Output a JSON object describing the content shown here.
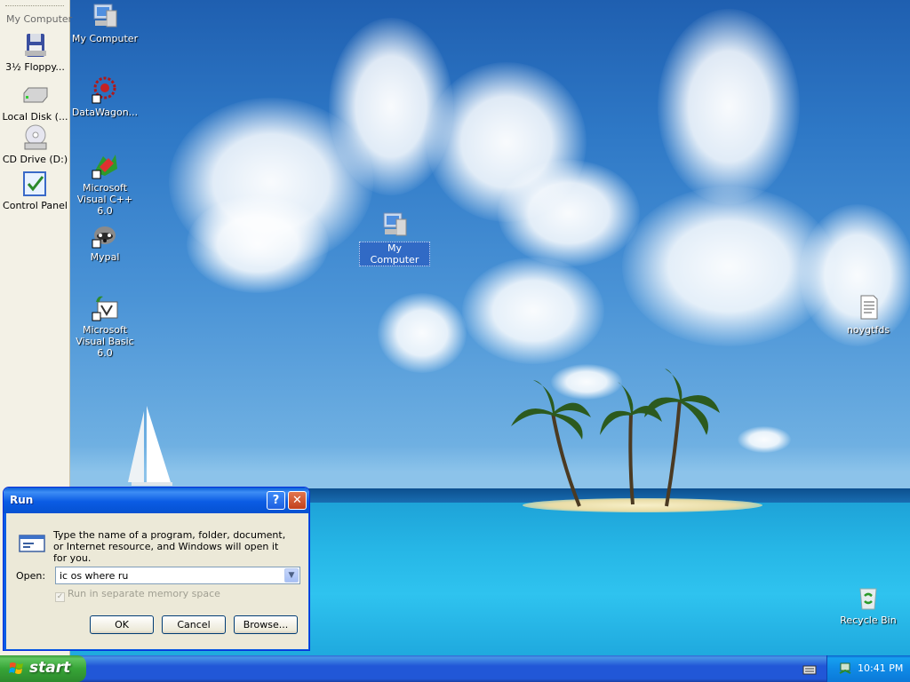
{
  "explorer_bar": {
    "title": "My Computer",
    "items": [
      {
        "label": "3½ Floppy...",
        "icon": "floppy-drive-icon"
      },
      {
        "label": "Local Disk (...",
        "icon": "hard-disk-icon"
      },
      {
        "label": "CD Drive (D:)",
        "icon": "cd-drive-icon"
      },
      {
        "label": "Control Panel",
        "icon": "control-panel-icon"
      }
    ]
  },
  "desktop": {
    "icons": [
      {
        "label": "My Computer",
        "icon": "my-computer-icon"
      },
      {
        "label": "DataWagon...",
        "icon": "datawagon-icon"
      },
      {
        "label": "Microsoft Visual C++ 6.0",
        "icon": "visual-cpp-icon"
      },
      {
        "label": "Mypal",
        "icon": "mypal-browser-icon"
      },
      {
        "label": "Microsoft Visual Basic 6.0",
        "icon": "visual-basic-icon"
      },
      {
        "label": "My Computer",
        "icon": "my-computer-icon",
        "selected": true
      },
      {
        "label": "noygtfds",
        "icon": "text-document-icon"
      },
      {
        "label": "Recycle Bin",
        "icon": "recycle-bin-icon"
      }
    ]
  },
  "run_dialog": {
    "title": "Run",
    "help_glyph": "?",
    "close_glyph": "✕",
    "description": "Type the name of a program, folder, document, or Internet resource, and Windows will open it for you.",
    "open_label": "Open:",
    "open_value": "ic os where ru",
    "checkbox_label": "Run in separate memory space",
    "checkbox_checked": true,
    "checkbox_enabled": false,
    "ok_label": "OK",
    "cancel_label": "Cancel",
    "browse_label": "Browse..."
  },
  "taskbar": {
    "start_label": "start",
    "clock": "10:41 PM"
  },
  "colors": {
    "taskbar_blue": "#2157d7",
    "start_green": "#37a537",
    "dialog_face": "#ece9d8",
    "selection_blue": "#316ac5"
  }
}
